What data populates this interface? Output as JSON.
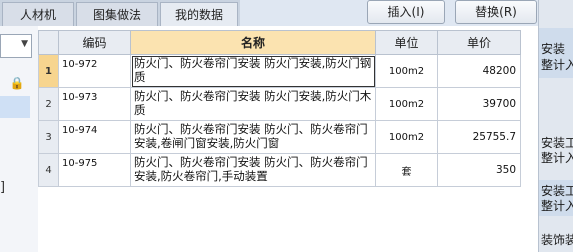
{
  "tabs": [
    "人材机",
    "图集做法",
    "我的数据"
  ],
  "buttons": {
    "insert": "插入(I)",
    "replace": "替换(R)"
  },
  "table": {
    "headers": {
      "code": "编码",
      "name": "名称",
      "unit": "单位",
      "price": "单价"
    },
    "rows": [
      {
        "num": "1",
        "code": "10-972",
        "name": "防火门、防火卷帘门安装 防火门安装,防火门钢质",
        "unit": "100m2",
        "price": "48200"
      },
      {
        "num": "2",
        "code": "10-973",
        "name": "防火门、防火卷帘门安装 防火门安装,防火门木质",
        "unit": "100m2",
        "price": "39700"
      },
      {
        "num": "3",
        "code": "10-974",
        "name": "防火门、防火卷帘门安装 防火门、防火卷帘门安装,卷闸门窗安装,防火门窗",
        "unit": "100m2",
        "price": "25755.7"
      },
      {
        "num": "4",
        "code": "10-975",
        "name": "防火门、防火卷帘门安装 防火门、防火卷帘门安装,防火卷帘门,手动装置",
        "unit": "套",
        "price": "350"
      }
    ]
  },
  "right_panel": {
    "item1_line1": "安装",
    "item1_line2": "整计入",
    "item2_line1": "安装工",
    "item2_line2": "整计入",
    "item3_line1": "安装工",
    "item3_line2": "整计入",
    "item4": "装饰装"
  },
  "left_panel": {
    "glyph": "]"
  }
}
